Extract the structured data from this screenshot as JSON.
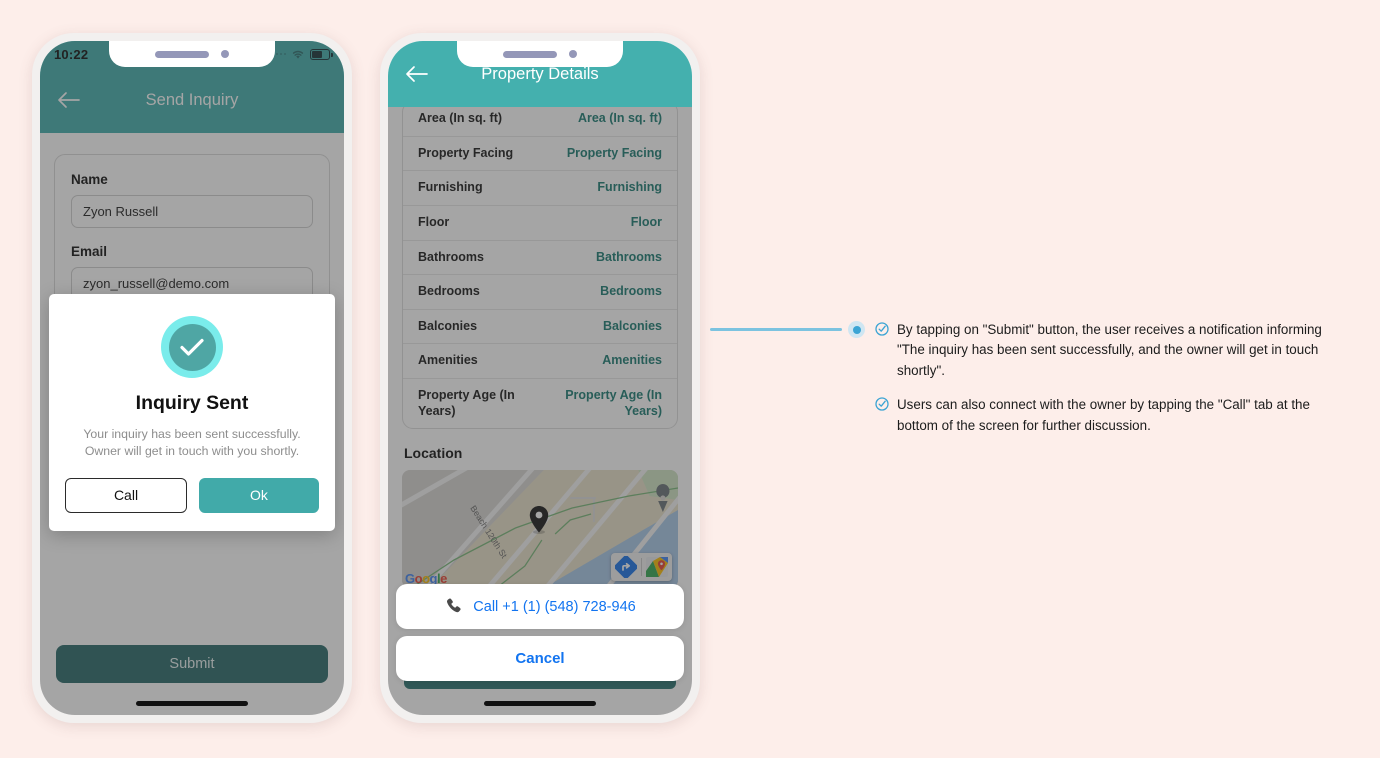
{
  "background_color": "#fdeeea",
  "accent_teal": "#44b0ae",
  "accent_dark_teal": "#2a6b6b",
  "link_blue": "#1274f0",
  "annotation_blue": "#3ba4d4",
  "phone1": {
    "status_bar": {
      "time": "10:22",
      "signal_icon": "signal-dots-icon",
      "wifi_icon": "wifi-icon",
      "battery_icon": "battery-icon"
    },
    "header": {
      "back_icon": "back-arrow-icon",
      "title": "Send Inquiry"
    },
    "form": {
      "name_label": "Name",
      "name_value": "Zyon Russell",
      "email_label": "Email",
      "email_value": "zyon_russell@demo.com"
    },
    "submit_label": "Submit",
    "modal": {
      "success_icon": "check-circle-icon",
      "title": "Inquiry Sent",
      "message": "Your inquiry has been sent successfully. Owner will get in touch with you shortly.",
      "call_label": "Call",
      "ok_label": "Ok"
    }
  },
  "phone2": {
    "header": {
      "back_icon": "back-arrow-icon",
      "title": "Property Details"
    },
    "details": [
      {
        "key": "Area (In sq. ft)",
        "value": "Area (In sq. ft)"
      },
      {
        "key": "Property Facing",
        "value": "Property Facing"
      },
      {
        "key": "Furnishing",
        "value": "Furnishing"
      },
      {
        "key": "Floor",
        "value": "Floor"
      },
      {
        "key": "Bathrooms",
        "value": "Bathrooms"
      },
      {
        "key": "Bedrooms",
        "value": "Bedrooms"
      },
      {
        "key": "Balconies",
        "value": "Balconies"
      },
      {
        "key": "Amenities",
        "value": "Amenities"
      },
      {
        "key": "Property Age (In Years)",
        "value": "Property Age (In Years)"
      }
    ],
    "location_title": "Location",
    "map": {
      "street_label": "Beach 120th St",
      "pin_icon": "map-pin-icon",
      "logo_text": "Google",
      "directions_icon": "directions-arrow-icon",
      "open-maps_icon": "google-maps-badge-icon"
    },
    "action_sheet": {
      "phone_icon": "phone-handset-icon",
      "call_label": "Call +1 (1) (548) 728-946",
      "cancel_label": "Cancel"
    }
  },
  "annotation": {
    "items": [
      "By tapping on \"Submit\" button, the user receives a notification informing \"The inquiry has been sent successfully, and the owner will get in touch shortly\".",
      "Users can also connect with the owner by tapping the \"Call\" tab at the bottom of the screen for further discussion."
    ]
  }
}
